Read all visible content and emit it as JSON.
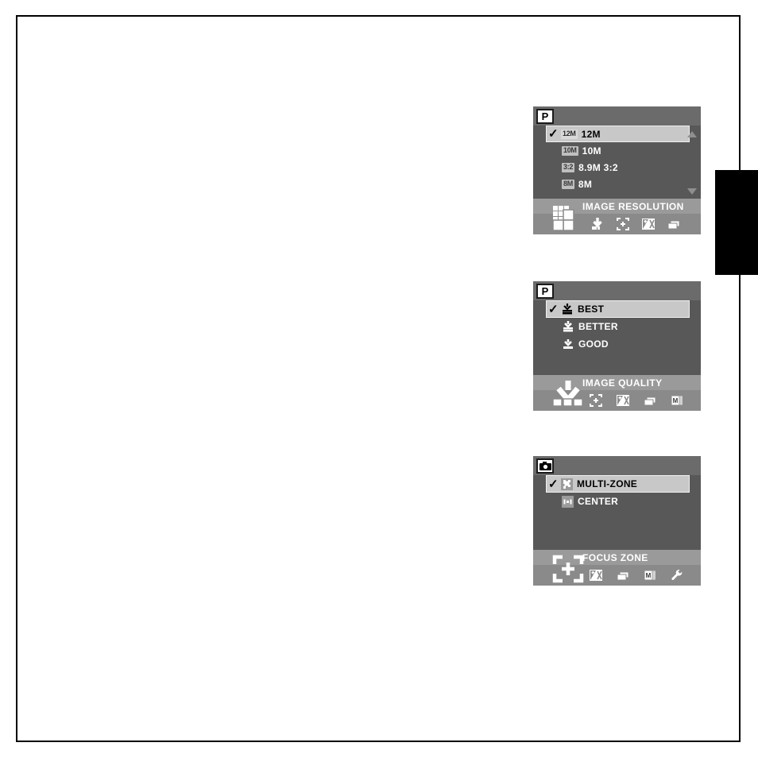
{
  "page": {
    "background_color": "#ffffff",
    "border_color": "#000000",
    "side_tab_color": "#000000"
  },
  "panels": [
    {
      "id": "image-resolution",
      "mode_badge": "P",
      "mode_badge_icon": "letter-p-badge",
      "title": "IMAGE RESOLUTION",
      "active_tool_icon": "image-resolution-grid-icon",
      "scroll_up": true,
      "scroll_down": true,
      "options": [
        {
          "chip": "12M",
          "label": "12M",
          "selected": true,
          "check": "✓"
        },
        {
          "chip": "10M",
          "label": "10M",
          "selected": false,
          "check": ""
        },
        {
          "chip": "3:2",
          "label": "8.9M 3:2",
          "selected": false,
          "check": ""
        },
        {
          "chip": "8M",
          "label": "8M",
          "selected": false,
          "check": ""
        }
      ],
      "toolbar_icons": [
        "image-quality-arrow-icon",
        "focus-zone-bracket-icon",
        "exposure-compensation-icon",
        "burst-frames-icon"
      ]
    },
    {
      "id": "image-quality",
      "mode_badge": "P",
      "mode_badge_icon": "letter-p-badge",
      "title": "IMAGE QUALITY",
      "active_tool_icon": "image-quality-arrow-bars-icon",
      "scroll_up": false,
      "scroll_down": false,
      "options": [
        {
          "icon": "quality-best-icon",
          "label": "BEST",
          "selected": true,
          "check": "✓"
        },
        {
          "icon": "quality-better-icon",
          "label": "BETTER",
          "selected": false,
          "check": ""
        },
        {
          "icon": "quality-good-icon",
          "label": "GOOD",
          "selected": false,
          "check": ""
        }
      ],
      "toolbar_icons": [
        "focus-zone-bracket-icon",
        "exposure-compensation-icon",
        "burst-frames-icon",
        "manual-pages-icon"
      ]
    },
    {
      "id": "focus-zone",
      "mode_badge": "",
      "mode_badge_icon": "camera-badge",
      "title": "FOCUS ZONE",
      "active_tool_icon": "focus-zone-bracket-plus-icon",
      "scroll_up": false,
      "scroll_down": false,
      "options": [
        {
          "icon": "multi-zone-icon",
          "label": "MULTI-ZONE",
          "selected": true,
          "check": "✓"
        },
        {
          "icon": "center-zone-icon",
          "label": "CENTER",
          "selected": false,
          "check": ""
        }
      ],
      "toolbar_icons": [
        "exposure-compensation-icon",
        "burst-frames-icon",
        "manual-pages-icon",
        "setup-wrench-icon"
      ]
    }
  ]
}
